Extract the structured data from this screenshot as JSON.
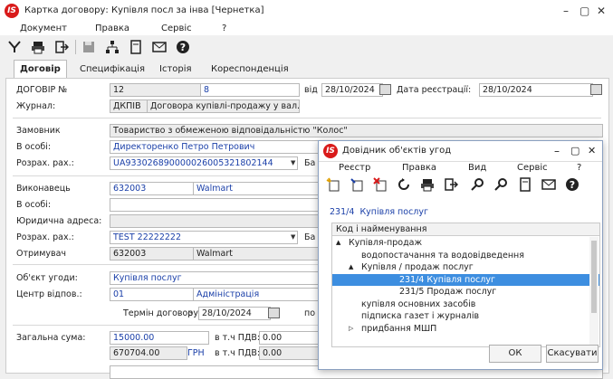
{
  "window": {
    "title": "Картка договору:  Купівля посл за інва [Чернетка]",
    "logo": "IS"
  },
  "menu": [
    "Документ",
    "Правка",
    "Сервіс",
    "?"
  ],
  "tabs": [
    "Договір",
    "Специфікація",
    "Історія",
    "Кореспонденція"
  ],
  "form": {
    "contract_no_label": "ДОГОВІР №",
    "contract_no_1": "12",
    "contract_no_2": "8",
    "from_label": "від",
    "from_date": "28/10/2024",
    "reg_date_label": "Дата реєстрації:",
    "reg_date": "28/10/2024",
    "journal_label": "Журнал:",
    "journal_code": "ДКПІВ",
    "journal_name": "Договора купівлі-продажу у вал...",
    "customer_label": "Замовник",
    "customer_value": "Товариство з обмеженою відповідальністю \"Колос\"",
    "person_label": "В особі:",
    "person_value": "Директоренко Петро Петрович",
    "account_label": "Розрах. рах.:",
    "account_value": "UA933026890000026005321802144",
    "bank_label_clip": "Ба",
    "executor_label": "Виконавець",
    "executor_code": "632003",
    "executor_name": "Walmart",
    "person2_label": "В особі:",
    "legal_address_label": "Юридична адреса:",
    "account2_label": "Розрах. рах.:",
    "account2_value": "TEST 22222222",
    "bank2_label_clip": "Ба",
    "receiver_label": "Отримувач",
    "receiver_code": "632003",
    "receiver_name": "Walmart",
    "object_label": "Об'єкт угоди:",
    "object_value": "Купівля послуг",
    "cost_center_label": "Центр відпов.:",
    "cost_center_code": "01",
    "cost_center_name": "Адміністрація",
    "term_label": "Термін договору:",
    "term_from": "з",
    "term_date": "28/10/2024",
    "term_to_clip": "по",
    "total_label": "Загальна сума:",
    "total_value": "15000.00",
    "vat_label": "в т.ч ПДВ:",
    "vat_value": "0.00",
    "total2_value": "670704.00",
    "currency": "ГРН",
    "vat2_label": "в т.ч ПДВ:",
    "vat2_value": "0.00"
  },
  "dialog": {
    "title": "Довідник об'єктів угод",
    "menu": [
      "Реєстр",
      "Правка",
      "Вид",
      "Сервіс",
      "?"
    ],
    "current_code": "231/4",
    "current_name": "Купівля послуг",
    "column_header": "Код і найменування",
    "tree": [
      {
        "text": "Купівля-продаж",
        "level": 0,
        "toggle": "▲"
      },
      {
        "text": "водопостачання та водовідведення",
        "level": 1,
        "toggle": ""
      },
      {
        "text": "Купівля / продаж послуг",
        "level": 1,
        "toggle": "▲"
      },
      {
        "text": "231/4  Купівля послуг",
        "level": 2,
        "toggle": "",
        "selected": true
      },
      {
        "text": "231/5  Продаж послуг",
        "level": 2,
        "toggle": ""
      },
      {
        "text": "купівля основних засобів",
        "level": 1,
        "toggle": ""
      },
      {
        "text": "підписка газет і журналів",
        "level": 1,
        "toggle": ""
      },
      {
        "text": "придбання МШП",
        "level": 1,
        "toggle": "▷"
      }
    ],
    "ok_label": "ОК",
    "cancel_label": "Скасувати"
  },
  "colors": {
    "selection": "#3d8ee0",
    "link_blue": "#1a3fa8",
    "logo_red": "#d91a1a"
  }
}
